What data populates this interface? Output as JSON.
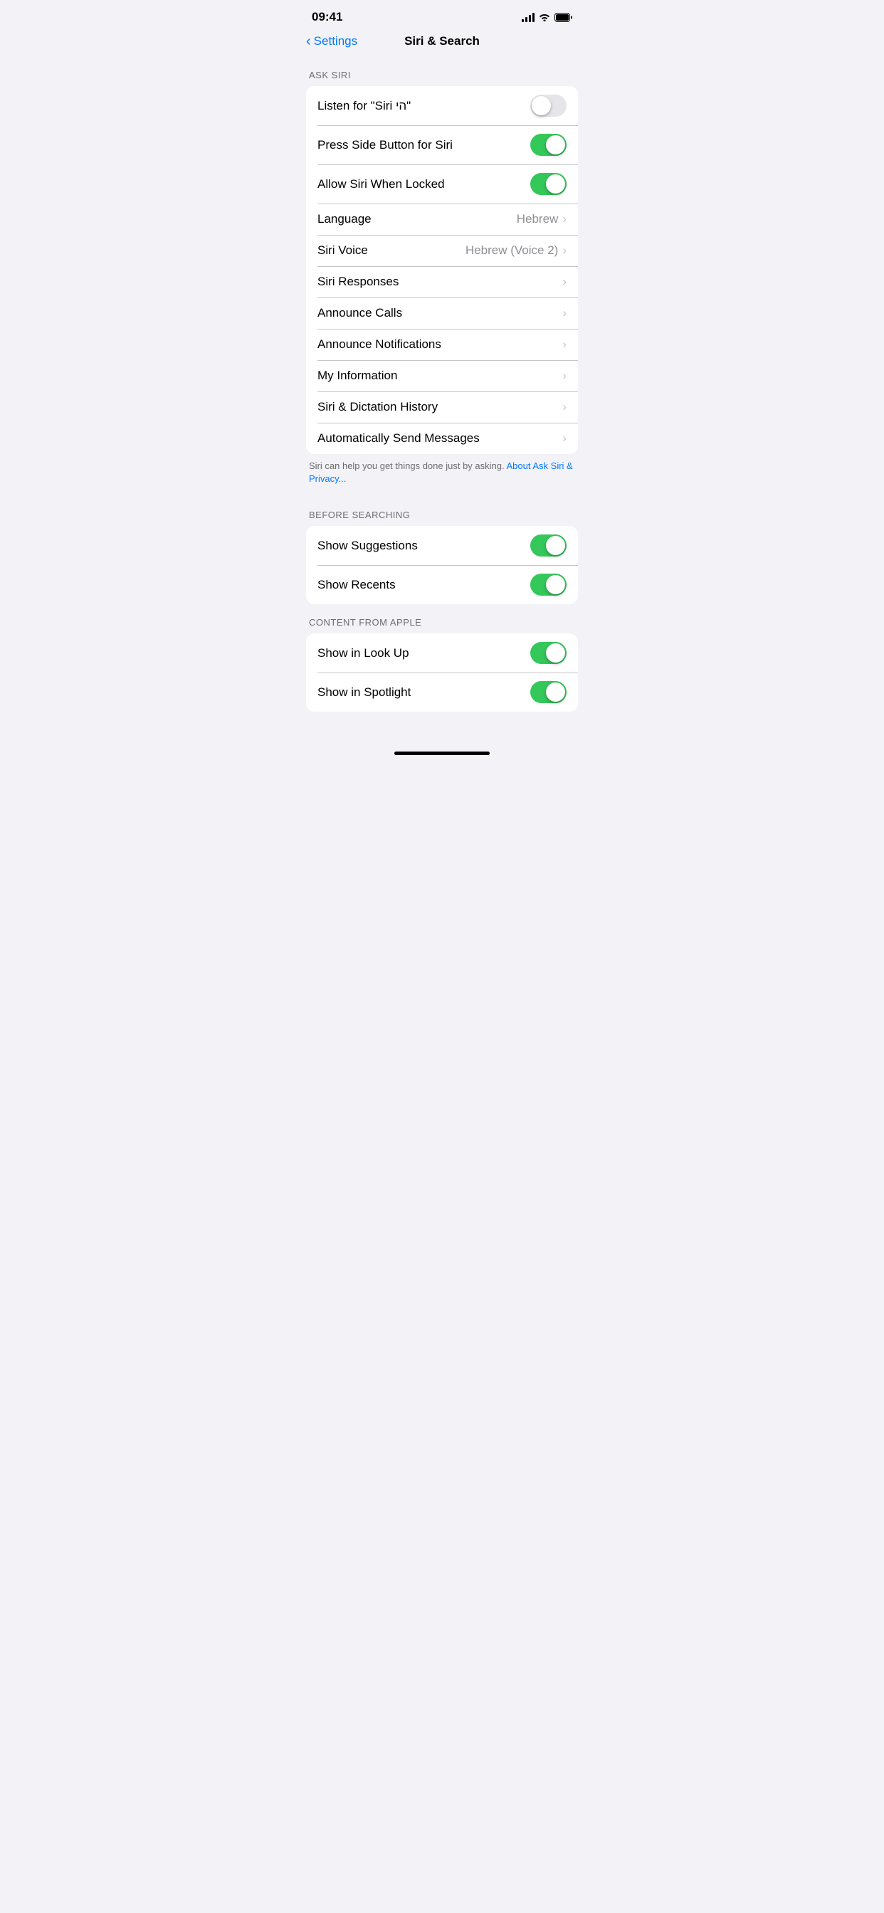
{
  "statusBar": {
    "time": "09:41"
  },
  "navBar": {
    "backLabel": "Settings",
    "title": "Siri & Search"
  },
  "sections": [
    {
      "id": "ask-siri",
      "header": "ASK SIRI",
      "footer": "Siri can help you get things done just by asking. About Ask Siri & Privacy...",
      "footerLinkText": "About Ask Siri & Privacy...",
      "rows": [
        {
          "id": "listen-siri",
          "label": "Listen for “Siri היי”",
          "type": "toggle",
          "toggleOn": false
        },
        {
          "id": "press-side-button",
          "label": "Press Side Button for Siri",
          "type": "toggle",
          "toggleOn": true
        },
        {
          "id": "allow-locked",
          "label": "Allow Siri When Locked",
          "type": "toggle",
          "toggleOn": true
        },
        {
          "id": "language",
          "label": "Language",
          "type": "value-chevron",
          "value": "Hebrew"
        },
        {
          "id": "siri-voice",
          "label": "Siri Voice",
          "type": "value-chevron",
          "value": "Hebrew (Voice 2)"
        },
        {
          "id": "siri-responses",
          "label": "Siri Responses",
          "type": "chevron",
          "value": ""
        },
        {
          "id": "announce-calls",
          "label": "Announce Calls",
          "type": "chevron",
          "value": ""
        },
        {
          "id": "announce-notifications",
          "label": "Announce Notifications",
          "type": "chevron",
          "value": ""
        },
        {
          "id": "my-information",
          "label": "My Information",
          "type": "chevron",
          "value": ""
        },
        {
          "id": "siri-dictation-history",
          "label": "Siri & Dictation History",
          "type": "chevron",
          "value": ""
        },
        {
          "id": "auto-send-messages",
          "label": "Automatically Send Messages",
          "type": "chevron",
          "value": ""
        }
      ]
    },
    {
      "id": "before-searching",
      "header": "BEFORE SEARCHING",
      "footer": "",
      "rows": [
        {
          "id": "show-suggestions",
          "label": "Show Suggestions",
          "type": "toggle",
          "toggleOn": true
        },
        {
          "id": "show-recents",
          "label": "Show Recents",
          "type": "toggle",
          "toggleOn": true
        }
      ]
    },
    {
      "id": "content-from-apple",
      "header": "CONTENT FROM APPLE",
      "footer": "",
      "rows": [
        {
          "id": "show-in-look-up",
          "label": "Show in Look Up",
          "type": "toggle",
          "toggleOn": true
        },
        {
          "id": "show-in-spotlight",
          "label": "Show in Spotlight",
          "type": "toggle",
          "toggleOn": true
        }
      ]
    }
  ]
}
